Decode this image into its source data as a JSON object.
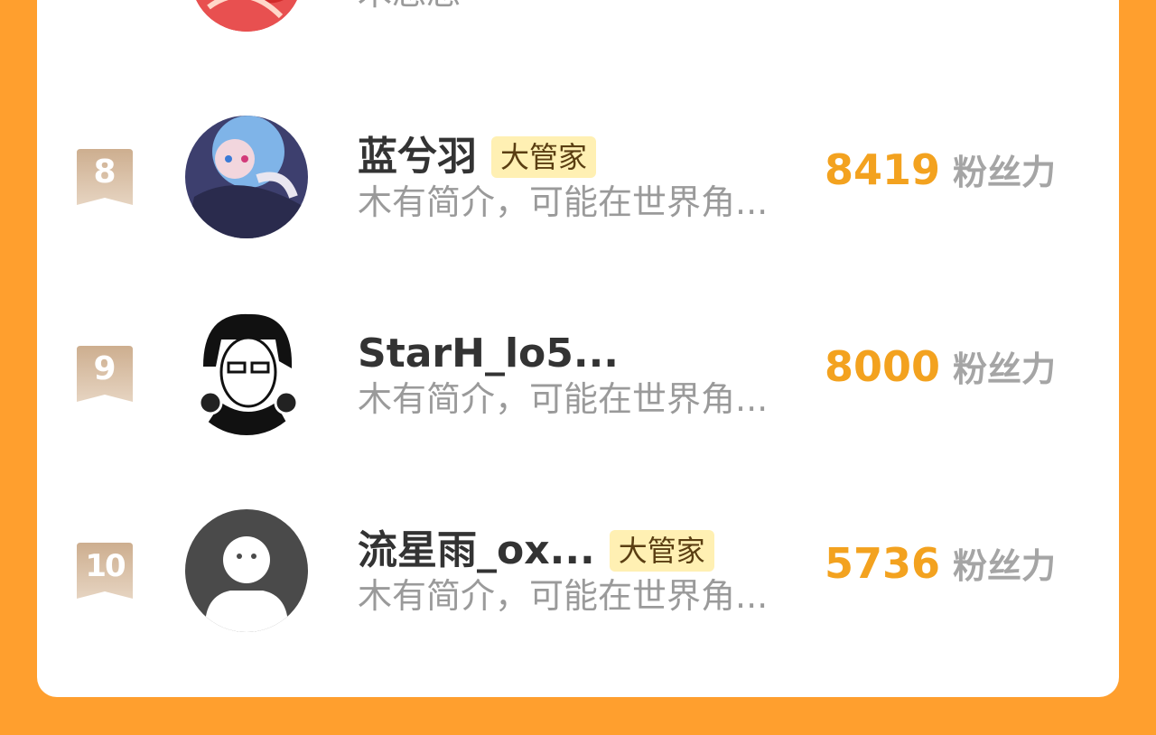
{
  "previous_row": {
    "bio": "木念念"
  },
  "rows": [
    {
      "rank": "8",
      "name": "蓝兮羽",
      "badge": "大管家",
      "bio": "木有简介，可能在世界角...",
      "score": "8419",
      "unit": "粉丝力",
      "avatar_icon": "anime-girl-avatar"
    },
    {
      "rank": "9",
      "name": "StarH_lo5...",
      "badge": "",
      "bio": "木有简介，可能在世界角...",
      "score": "8000",
      "unit": "粉丝力",
      "avatar_icon": "glasses-boy-avatar"
    },
    {
      "rank": "10",
      "name": "流星雨_ox...",
      "badge": "大管家",
      "bio": "木有简介，可能在世界角...",
      "score": "5736",
      "unit": "粉丝力",
      "avatar_icon": "default-avatar"
    }
  ],
  "colors": {
    "background": "#FF9F2E",
    "score": "#F3A21F",
    "badge_bg": "#FFF0B3",
    "rank_ribbon": "#D4B79A"
  }
}
